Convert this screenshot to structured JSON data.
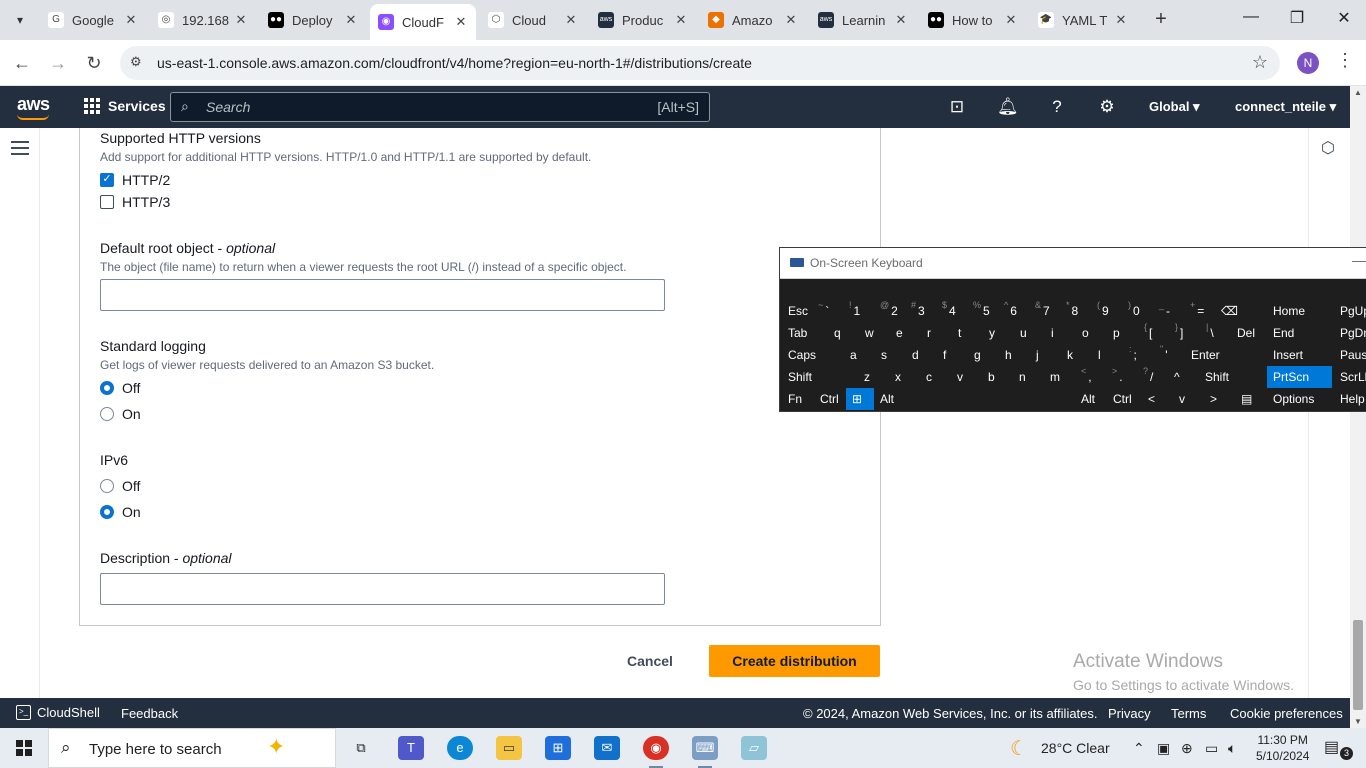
{
  "browser": {
    "tabs": [
      {
        "title": "Google",
        "favicon_color": "#ffffff",
        "favicon_glyph": "G"
      },
      {
        "title": "192.168",
        "favicon_color": "#ffffff",
        "favicon_glyph": "◎"
      },
      {
        "title": "Deploy",
        "favicon_color": "#000000",
        "favicon_glyph": "●●"
      },
      {
        "title": "CloudF",
        "favicon_color": "#8c4fff",
        "favicon_glyph": "◉"
      },
      {
        "title": "Cloud",
        "favicon_color": "#ffffff",
        "favicon_glyph": "⬡"
      },
      {
        "title": "Produc",
        "favicon_color": "#232f3e",
        "favicon_glyph": "aws"
      },
      {
        "title": "Amazo",
        "favicon_color": "#ed7100",
        "favicon_glyph": "◆"
      },
      {
        "title": "Learnin",
        "favicon_color": "#232f3e",
        "favicon_glyph": "aws"
      },
      {
        "title": "How to",
        "favicon_color": "#000000",
        "favicon_glyph": "●●"
      },
      {
        "title": "YAML T",
        "favicon_color": "#ffffff",
        "favicon_glyph": "🎓"
      }
    ],
    "active_tab_index": 3,
    "url": "us-east-1.console.aws.amazon.com/cloudfront/v4/home?region=eu-north-1#/distributions/create",
    "profile_initial": "N"
  },
  "aws_nav": {
    "logo": "aws",
    "services": "Services",
    "search_placeholder": "Search",
    "search_shortcut": "[Alt+S]",
    "region": "Global ▾",
    "account": "connect_nteile ▾"
  },
  "form": {
    "http_versions": {
      "label": "Supported HTTP versions",
      "description": "Add support for additional HTTP versions. HTTP/1.0 and HTTP/1.1 are supported by default.",
      "options": [
        {
          "label": "HTTP/2",
          "checked": true
        },
        {
          "label": "HTTP/3",
          "checked": false
        }
      ]
    },
    "default_root_object": {
      "label": "Default root object - ",
      "optional": "optional",
      "description": "The object (file name) to return when a viewer requests the root URL (/) instead of a specific object.",
      "value": ""
    },
    "standard_logging": {
      "label": "Standard logging",
      "description": "Get logs of viewer requests delivered to an Amazon S3 bucket.",
      "options": [
        {
          "label": "Off",
          "selected": true
        },
        {
          "label": "On",
          "selected": false
        }
      ]
    },
    "ipv6": {
      "label": "IPv6",
      "options": [
        {
          "label": "Off",
          "selected": false
        },
        {
          "label": "On",
          "selected": true
        }
      ]
    },
    "description_field": {
      "label": "Description - ",
      "optional": "optional",
      "value": ""
    },
    "cancel_label": "Cancel",
    "create_label": "Create distribution"
  },
  "activation": {
    "line1": "Activate Windows",
    "line2": "Go to Settings to activate Windows."
  },
  "aws_footer": {
    "cloudshell": "CloudShell",
    "feedback": "Feedback",
    "copyright": "© 2024, Amazon Web Services, Inc. or its affiliates.",
    "privacy": "Privacy",
    "terms": "Terms",
    "cookies": "Cookie preferences"
  },
  "osk": {
    "title": "On-Screen Keyboard",
    "rows": [
      [
        "Esc",
        "~ `",
        "! 1",
        "@ 2",
        "# 3",
        "$ 4",
        "% 5",
        "^ 6",
        "& 7",
        "* 8",
        "( 9",
        ") 0",
        "_ -",
        "+ =",
        "⌫"
      ],
      [
        "Tab",
        "q",
        "w",
        "e",
        "r",
        "t",
        "y",
        "u",
        "i",
        "o",
        "p",
        "{ [",
        "} ]",
        "| \\",
        "Del"
      ],
      [
        "Caps",
        "a",
        "s",
        "d",
        "f",
        "g",
        "h",
        "j",
        "k",
        "l",
        ": ;",
        "\" '",
        "Enter"
      ],
      [
        "Shift",
        "z",
        "x",
        "c",
        "v",
        "b",
        "n",
        "m",
        "< ,",
        "> .",
        "? /",
        "^",
        "Shift"
      ],
      [
        "Fn",
        "Ctrl",
        "⊞",
        "Alt",
        "",
        "Alt",
        "Ctrl",
        "<",
        "v",
        ">",
        "▤"
      ]
    ],
    "nav_keys": [
      [
        "Home",
        "PgUp"
      ],
      [
        "End",
        "PgDn"
      ],
      [
        "Insert",
        "Pause"
      ],
      [
        "PrtScn",
        "ScrLk"
      ],
      [
        "Options",
        "Help"
      ]
    ]
  },
  "taskbar": {
    "search_placeholder": "Type here to search",
    "weather": "28°C  Clear",
    "time": "11:30 PM",
    "date": "5/10/2024",
    "notification_count": "3"
  }
}
